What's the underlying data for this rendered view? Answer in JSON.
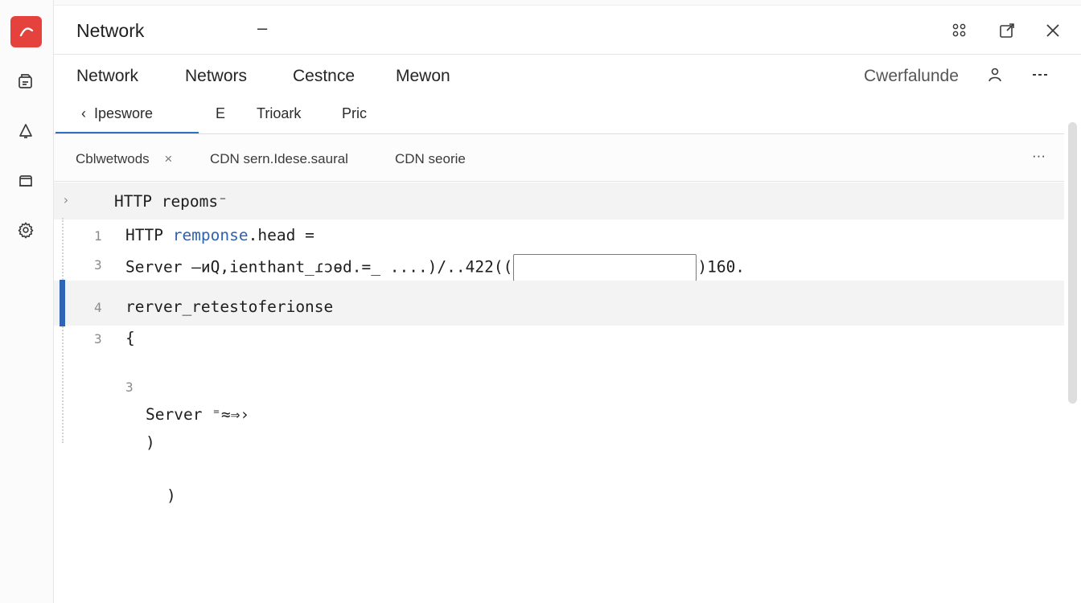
{
  "window": {
    "title": "Network",
    "title_suffix": "–"
  },
  "titlebar_actions": {
    "left_icon": "share-nodes-icon",
    "middle_icon": "open-external-icon",
    "right_icon": "close-icon"
  },
  "sidebar": {
    "logo_icon": "app-logo-icon",
    "items": [
      {
        "icon": "files-icon"
      },
      {
        "icon": "bell-icon"
      },
      {
        "icon": "inbox-icon"
      },
      {
        "icon": "gear-icon"
      }
    ]
  },
  "nav": {
    "items": [
      "Network",
      "Networs",
      "Cestnce",
      "Mewon"
    ],
    "right_label": "Cwerfalunde"
  },
  "subtabs": {
    "back_label": "Ipeswore",
    "items": [
      "E",
      "Trioark",
      "Pric"
    ]
  },
  "filters": {
    "chips": [
      "Cblwetwods",
      "CDN sern.Idese.saural",
      "CDN seorie"
    ],
    "chip_close": "×",
    "more": "···"
  },
  "editor": {
    "header_text": "HTTP repoms⁻",
    "lines": [
      {
        "num": "1",
        "pre": "HTTP ",
        "blue": "remponse",
        "post": ".head ="
      },
      {
        "num": "3",
        "pre": "Server –иQ,ienthant_ɾɔɵd.=_ ....)/..422((",
        "post": ")160."
      },
      {
        "num": "4",
        "text": "rerver_retestoferionse"
      },
      {
        "num": "3",
        "text": "{"
      },
      {
        "num": "3",
        "text": ""
      },
      {
        "num": "",
        "text": "Server ⁼≈⇒›"
      },
      {
        "num": "",
        "text": ")"
      },
      {
        "num": "",
        "text": ")"
      }
    ]
  },
  "colors": {
    "logo_red": "#e5413d",
    "accent_blue": "#2e63b5"
  }
}
